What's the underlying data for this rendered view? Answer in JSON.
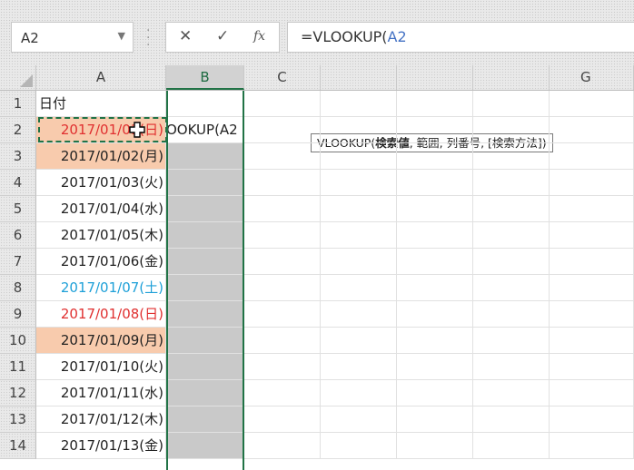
{
  "name_box": {
    "value": "A2",
    "dropdown_icon": "chevron-down-icon"
  },
  "formula_bar": {
    "cancel_icon": "close-icon",
    "enter_icon": "check-icon",
    "fx_label": "fx",
    "formula_prefix": "=VLOOKUP(",
    "formula_ref": "A2"
  },
  "columns": [
    "A",
    "B",
    "C",
    "G"
  ],
  "tooltip": {
    "prefix": "VLOOKUP(",
    "bold_arg": "検索値",
    "rest": ", 範囲, 列番号, [検索方法])"
  },
  "rows": [
    "1",
    "2",
    "3",
    "4",
    "5",
    "6",
    "7",
    "8",
    "9",
    "10",
    "11",
    "12",
    "13",
    "14"
  ],
  "cells": {
    "A1": "日付",
    "B2": "OOKUP(A2",
    "dates": [
      "2017/01/01(日)",
      "2017/01/02(月)",
      "2017/01/03(火)",
      "2017/01/04(水)",
      "2017/01/05(木)",
      "2017/01/06(金)",
      "2017/01/07(土)",
      "2017/01/08(日)",
      "2017/01/09(月)",
      "2017/01/10(火)",
      "2017/01/11(水)",
      "2017/01/12(木)",
      "2017/01/13(金)"
    ]
  },
  "colors": {
    "selection": "#217346",
    "highlight": "#f8cbad",
    "sunday_text": "#e03030",
    "saturday_text": "#1ea0d8",
    "ref_text": "#4472c4"
  }
}
